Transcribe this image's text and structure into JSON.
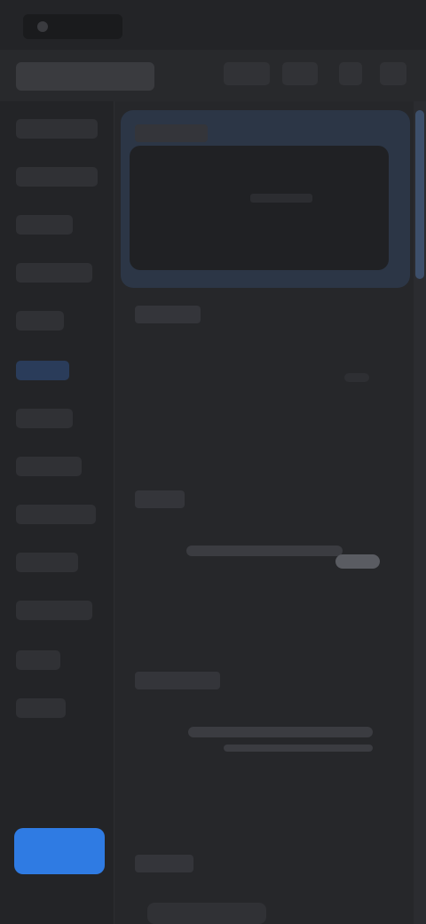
{
  "app": {
    "title": "",
    "top_actions": [
      "",
      "",
      ""
    ]
  },
  "sidebar": {
    "items": [
      {
        "label": ""
      },
      {
        "label": ""
      },
      {
        "label": ""
      },
      {
        "label": ""
      },
      {
        "label": ""
      },
      {
        "label": ""
      },
      {
        "label": ""
      },
      {
        "label": ""
      },
      {
        "label": ""
      },
      {
        "label": ""
      },
      {
        "label": ""
      },
      {
        "label": ""
      },
      {
        "label": ""
      }
    ],
    "active_index": 5,
    "primary_button_label": ""
  },
  "main": {
    "sections": [
      {
        "label": ""
      },
      {
        "label": ""
      },
      {
        "label": ""
      },
      {
        "label": ""
      },
      {
        "label": ""
      }
    ]
  },
  "colors": {
    "background": "#26272a",
    "sidebar": "#232427",
    "accent": "#2f7be3",
    "active_nav": "#2a3c5a"
  }
}
